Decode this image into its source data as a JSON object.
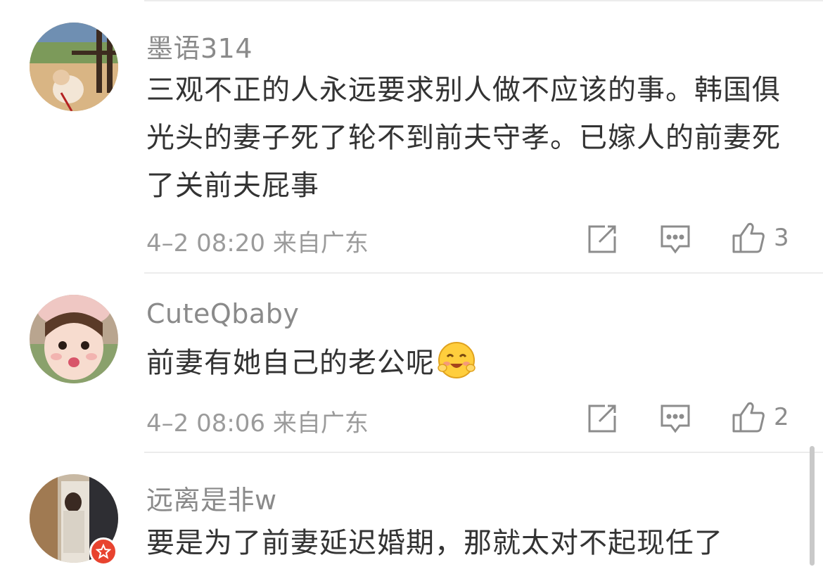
{
  "comments": [
    {
      "username": "墨语314",
      "text": "三观不正的人永远要求别人做不应该的事。韩国俱光头的妻子死了轮不到前夫守孝。已嫁人的前妻死了关前夫屁事",
      "meta": "4–2 08:20 来自广东",
      "likes": "3"
    },
    {
      "username": "CuteQbaby",
      "text": "前妻有她自己的老公呢",
      "meta": "4–2 08:06 来自广东",
      "likes": "2"
    },
    {
      "username": "远离是非w",
      "text": "要是为了前妻延迟婚期，那就太对不起现任了"
    }
  ],
  "icons": {
    "repost": "share-edit-icon",
    "comment": "comment-bubble-icon",
    "like": "thumbs-up-icon",
    "verified": "verified-badge-icon",
    "emoji": "blush-smile-emoji"
  },
  "colors": {
    "name": "#8a8a8a",
    "text": "#333333",
    "meta": "#9b9b9b",
    "badge": "#e8432f"
  }
}
